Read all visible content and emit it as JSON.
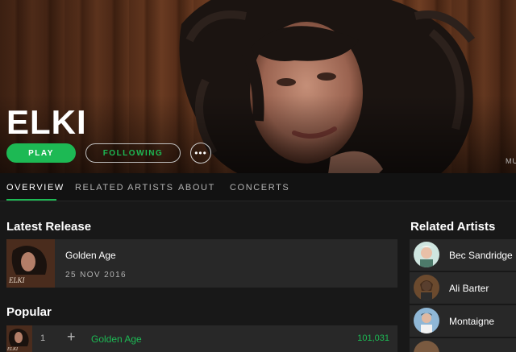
{
  "header": {
    "artist_name": "ELKI",
    "play_label": "PLAY",
    "following_label": "FOLLOWING",
    "more_label": "•••",
    "edge_text": "MU"
  },
  "tabs": [
    {
      "label": "OVERVIEW",
      "active": true
    },
    {
      "label": "RELATED ARTISTS",
      "active": false
    },
    {
      "label": "ABOUT",
      "active": false
    },
    {
      "label": "CONCERTS",
      "active": false
    }
  ],
  "latest_release": {
    "section_title": "Latest Release",
    "title": "Golden Age",
    "date": "25 NOV 2016",
    "art_text": "ELKI"
  },
  "popular": {
    "section_title": "Popular",
    "tracks": [
      {
        "number": "1",
        "add_icon": "+",
        "title": "Golden Age",
        "plays": "101,031",
        "art_text": "ELKI"
      }
    ]
  },
  "related": {
    "section_title": "Related Artists",
    "artists": [
      {
        "name": "Bec Sandridge"
      },
      {
        "name": "Ali Barter"
      },
      {
        "name": "Montaigne"
      }
    ]
  },
  "colors": {
    "accent": "#1db954",
    "background": "#181818",
    "card": "#282828"
  }
}
